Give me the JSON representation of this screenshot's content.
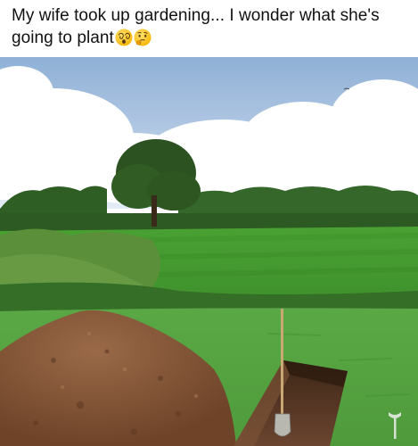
{
  "post": {
    "caption_line1": "My wife took up gardening... I wonder what she's",
    "caption_line2": "going to plant",
    "emojis": [
      "dizzy-face-emoji",
      "thinking-face-emoji"
    ]
  },
  "photo": {
    "subject": "grave-like hole with dirt pile and shovel in a grassy field",
    "colors": {
      "sky": "#a9c3e0",
      "cloud": "#ffffff",
      "grass": "#4f9e3a",
      "soil": "#8a5a3a"
    }
  }
}
